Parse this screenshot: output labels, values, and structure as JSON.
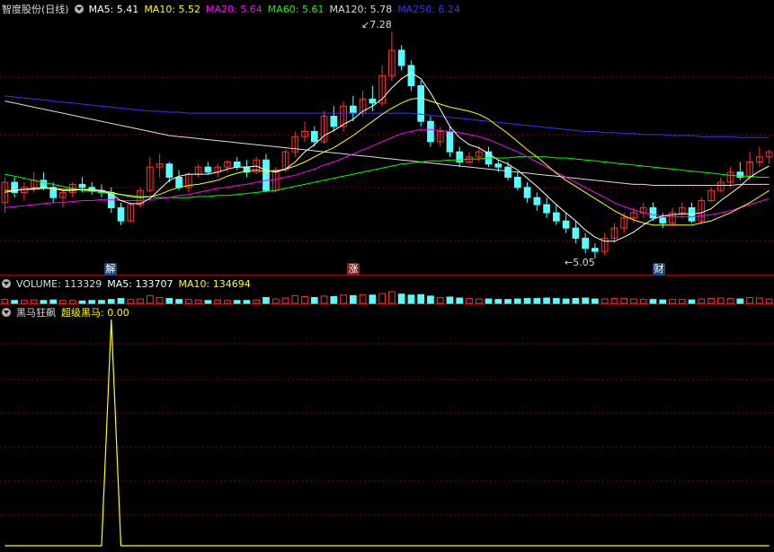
{
  "main": {
    "title": "智度股份(日线)",
    "ma_legend": [
      {
        "label": "MA5: 5.41",
        "color": "#ffffff"
      },
      {
        "label": "MA10: 5.52",
        "color": "#ffff00"
      },
      {
        "label": "MA20: 5.64",
        "color": "#ff00ff"
      },
      {
        "label": "MA60: 5.61",
        "color": "#00ff00"
      },
      {
        "label": "MA120: 5.78",
        "color": "#dddddd"
      },
      {
        "label": "MA250: 6.24",
        "color": "#3333ff"
      }
    ],
    "high_label": "7.28",
    "low_label": "5.05",
    "markers": [
      {
        "text": "解",
        "bg": "#1e4a7a"
      },
      {
        "text": "涨",
        "bg": "#8b1a1a"
      },
      {
        "text": "财",
        "bg": "#1e4a7a"
      }
    ]
  },
  "volume": {
    "title": "VOLUME: 113329",
    "ma5": "MA5: 133707",
    "ma10": "MA10: 134694"
  },
  "indicator": {
    "title": "黑马狂飙",
    "series_label": "超级黑马: 0.00"
  },
  "colors": {
    "up": "#ff3030",
    "down": "#54ffff",
    "grid": "#8b0000",
    "ma5": "#ffffff",
    "ma10": "#ffff00",
    "ma20": "#ff00ff",
    "ma60": "#00ff00",
    "ma120": "#dddddd",
    "ma250": "#3333ff",
    "indicator": "#ffff00"
  },
  "chart_data": {
    "type": "candlestick",
    "ylim": [
      4.9,
      7.4
    ],
    "candles": [
      [
        5.6,
        5.85,
        5.5,
        5.8
      ],
      [
        5.8,
        5.85,
        5.65,
        5.7
      ],
      [
        5.7,
        5.8,
        5.62,
        5.75
      ],
      [
        5.75,
        5.9,
        5.7,
        5.82
      ],
      [
        5.82,
        5.9,
        5.72,
        5.75
      ],
      [
        5.75,
        5.8,
        5.6,
        5.65
      ],
      [
        5.65,
        5.72,
        5.55,
        5.7
      ],
      [
        5.7,
        5.8,
        5.65,
        5.78
      ],
      [
        5.78,
        5.85,
        5.7,
        5.75
      ],
      [
        5.75,
        5.8,
        5.68,
        5.72
      ],
      [
        5.72,
        5.78,
        5.65,
        5.7
      ],
      [
        5.7,
        5.75,
        5.5,
        5.55
      ],
      [
        5.55,
        5.6,
        5.38,
        5.42
      ],
      [
        5.42,
        5.6,
        5.4,
        5.58
      ],
      [
        5.58,
        5.75,
        5.55,
        5.72
      ],
      [
        5.72,
        6.05,
        5.7,
        5.95
      ],
      [
        5.95,
        6.08,
        5.85,
        5.98
      ],
      [
        5.98,
        6.0,
        5.8,
        5.85
      ],
      [
        5.85,
        5.92,
        5.72,
        5.75
      ],
      [
        5.75,
        5.9,
        5.7,
        5.88
      ],
      [
        5.88,
        5.98,
        5.85,
        5.95
      ],
      [
        5.95,
        6.0,
        5.88,
        5.9
      ],
      [
        5.9,
        5.98,
        5.85,
        5.95
      ],
      [
        5.95,
        6.02,
        5.9,
        6.0
      ],
      [
        6.0,
        6.05,
        5.92,
        5.95
      ],
      [
        5.95,
        6.02,
        5.85,
        5.9
      ],
      [
        5.9,
        6.05,
        5.88,
        6.02
      ],
      [
        6.02,
        6.08,
        5.7,
        5.72
      ],
      [
        5.72,
        5.95,
        5.7,
        5.92
      ],
      [
        5.92,
        6.12,
        5.9,
        6.1
      ],
      [
        6.1,
        6.3,
        6.05,
        6.25
      ],
      [
        6.25,
        6.4,
        6.2,
        6.3
      ],
      [
        6.3,
        6.35,
        6.15,
        6.2
      ],
      [
        6.2,
        6.5,
        6.18,
        6.45
      ],
      [
        6.45,
        6.55,
        6.3,
        6.35
      ],
      [
        6.35,
        6.6,
        6.3,
        6.55
      ],
      [
        6.55,
        6.65,
        6.4,
        6.48
      ],
      [
        6.48,
        6.7,
        6.45,
        6.62
      ],
      [
        6.62,
        6.75,
        6.5,
        6.58
      ],
      [
        6.58,
        6.95,
        6.55,
        6.85
      ],
      [
        6.85,
        7.28,
        6.8,
        7.1
      ],
      [
        7.1,
        7.15,
        6.9,
        6.95
      ],
      [
        6.95,
        7.0,
        6.7,
        6.75
      ],
      [
        6.75,
        6.8,
        6.35,
        6.4
      ],
      [
        6.4,
        6.45,
        6.15,
        6.2
      ],
      [
        6.2,
        6.35,
        6.15,
        6.3
      ],
      [
        6.3,
        6.35,
        6.05,
        6.1
      ],
      [
        6.1,
        6.15,
        5.95,
        6.0
      ],
      [
        6.0,
        6.1,
        5.98,
        6.05
      ],
      [
        6.05,
        6.15,
        6.0,
        6.1
      ],
      [
        6.1,
        6.15,
        5.95,
        5.98
      ],
      [
        5.98,
        6.02,
        5.9,
        5.95
      ],
      [
        5.95,
        6.0,
        5.82,
        5.85
      ],
      [
        5.85,
        5.9,
        5.72,
        5.75
      ],
      [
        5.75,
        5.8,
        5.6,
        5.65
      ],
      [
        5.65,
        5.7,
        5.52,
        5.58
      ],
      [
        5.58,
        5.65,
        5.45,
        5.5
      ],
      [
        5.5,
        5.58,
        5.38,
        5.42
      ],
      [
        5.42,
        5.5,
        5.3,
        5.35
      ],
      [
        5.35,
        5.42,
        5.2,
        5.25
      ],
      [
        5.25,
        5.3,
        5.1,
        5.15
      ],
      [
        5.15,
        5.2,
        5.05,
        5.12
      ],
      [
        5.12,
        5.3,
        5.08,
        5.25
      ],
      [
        5.25,
        5.4,
        5.2,
        5.35
      ],
      [
        5.35,
        5.5,
        5.3,
        5.45
      ],
      [
        5.45,
        5.55,
        5.4,
        5.5
      ],
      [
        5.5,
        5.6,
        5.45,
        5.55
      ],
      [
        5.55,
        5.6,
        5.42,
        5.45
      ],
      [
        5.45,
        5.5,
        5.35,
        5.4
      ],
      [
        5.4,
        5.55,
        5.38,
        5.5
      ],
      [
        5.5,
        5.6,
        5.45,
        5.55
      ],
      [
        5.55,
        5.6,
        5.4,
        5.42
      ],
      [
        5.42,
        5.65,
        5.4,
        5.62
      ],
      [
        5.62,
        5.75,
        5.6,
        5.72
      ],
      [
        5.72,
        5.85,
        5.7,
        5.8
      ],
      [
        5.8,
        5.95,
        5.75,
        5.9
      ],
      [
        5.9,
        6.0,
        5.82,
        5.85
      ],
      [
        5.85,
        6.1,
        5.82,
        6.0
      ],
      [
        6.0,
        6.15,
        5.95,
        6.05
      ],
      [
        6.05,
        6.12,
        5.98,
        6.1
      ]
    ],
    "ma5": [
      5.7,
      5.72,
      5.73,
      5.74,
      5.75,
      5.74,
      5.72,
      5.72,
      5.73,
      5.72,
      5.72,
      5.68,
      5.62,
      5.59,
      5.59,
      5.64,
      5.73,
      5.82,
      5.86,
      5.88,
      5.88,
      5.88,
      5.9,
      5.93,
      5.95,
      5.95,
      5.96,
      5.92,
      5.9,
      5.93,
      6.0,
      6.1,
      6.17,
      6.26,
      6.31,
      6.37,
      6.42,
      6.5,
      6.55,
      6.62,
      6.73,
      6.82,
      6.88,
      6.82,
      6.68,
      6.52,
      6.35,
      6.24,
      6.17,
      6.14,
      6.08,
      6.02,
      5.98,
      5.92,
      5.84,
      5.76,
      5.67,
      5.58,
      5.5,
      5.42,
      5.33,
      5.26,
      5.22,
      5.22,
      5.26,
      5.31,
      5.38,
      5.44,
      5.47,
      5.48,
      5.49,
      5.49,
      5.5,
      5.54,
      5.62,
      5.69,
      5.76,
      5.85,
      5.91,
      5.96
    ],
    "ma10": [
      5.72,
      5.72,
      5.73,
      5.73,
      5.74,
      5.74,
      5.73,
      5.73,
      5.73,
      5.73,
      5.72,
      5.7,
      5.68,
      5.66,
      5.65,
      5.66,
      5.68,
      5.72,
      5.75,
      5.77,
      5.78,
      5.8,
      5.82,
      5.86,
      5.89,
      5.91,
      5.92,
      5.91,
      5.91,
      5.93,
      5.96,
      6.0,
      6.05,
      6.1,
      6.14,
      6.2,
      6.26,
      6.33,
      6.4,
      6.47,
      6.53,
      6.58,
      6.62,
      6.63,
      6.6,
      6.57,
      6.54,
      6.52,
      6.5,
      6.47,
      6.42,
      6.35,
      6.28,
      6.2,
      6.12,
      6.05,
      5.97,
      5.89,
      5.82,
      5.76,
      5.7,
      5.64,
      5.58,
      5.52,
      5.47,
      5.43,
      5.4,
      5.38,
      5.38,
      5.38,
      5.38,
      5.38,
      5.4,
      5.42,
      5.46,
      5.5,
      5.55,
      5.6,
      5.66,
      5.72
    ],
    "ma20": [
      5.55,
      5.56,
      5.57,
      5.58,
      5.59,
      5.6,
      5.6,
      5.61,
      5.62,
      5.62,
      5.63,
      5.63,
      5.62,
      5.62,
      5.62,
      5.63,
      5.64,
      5.65,
      5.67,
      5.68,
      5.7,
      5.72,
      5.74,
      5.75,
      5.77,
      5.78,
      5.8,
      5.82,
      5.83,
      5.85,
      5.87,
      5.9,
      5.93,
      5.97,
      6.0,
      6.04,
      6.08,
      6.12,
      6.16,
      6.2,
      6.24,
      6.28,
      6.3,
      6.32,
      6.32,
      6.31,
      6.3,
      6.29,
      6.27,
      6.25,
      6.22,
      6.18,
      6.14,
      6.1,
      6.05,
      6.0,
      5.95,
      5.9,
      5.85,
      5.8,
      5.75,
      5.7,
      5.65,
      5.6,
      5.56,
      5.53,
      5.5,
      5.48,
      5.47,
      5.46,
      5.46,
      5.46,
      5.47,
      5.48,
      5.5,
      5.52,
      5.55,
      5.58,
      5.61,
      5.64
    ],
    "ma60": [
      5.88,
      5.86,
      5.84,
      5.82,
      5.8,
      5.78,
      5.76,
      5.74,
      5.72,
      5.71,
      5.7,
      5.69,
      5.68,
      5.67,
      5.66,
      5.66,
      5.65,
      5.65,
      5.65,
      5.65,
      5.66,
      5.66,
      5.67,
      5.67,
      5.68,
      5.69,
      5.7,
      5.71,
      5.72,
      5.74,
      5.76,
      5.78,
      5.8,
      5.82,
      5.84,
      5.86,
      5.88,
      5.9,
      5.92,
      5.94,
      5.96,
      5.98,
      5.99,
      6.0,
      6.01,
      6.01,
      6.02,
      6.02,
      6.03,
      6.03,
      6.04,
      6.04,
      6.04,
      6.05,
      6.05,
      6.05,
      6.05,
      6.04,
      6.04,
      6.03,
      6.02,
      6.01,
      6.0,
      5.99,
      5.98,
      5.97,
      5.96,
      5.95,
      5.94,
      5.93,
      5.92,
      5.91,
      5.9,
      5.89,
      5.88,
      5.87,
      5.86,
      5.86,
      5.85,
      5.85
    ],
    "ma120": [
      6.6,
      6.58,
      6.56,
      6.54,
      6.52,
      6.5,
      6.48,
      6.46,
      6.44,
      6.42,
      6.4,
      6.38,
      6.36,
      6.34,
      6.32,
      6.3,
      6.28,
      6.26,
      6.25,
      6.24,
      6.23,
      6.22,
      6.21,
      6.2,
      6.19,
      6.18,
      6.17,
      6.16,
      6.15,
      6.14,
      6.13,
      6.12,
      6.11,
      6.1,
      6.09,
      6.08,
      6.07,
      6.06,
      6.05,
      6.04,
      6.03,
      6.02,
      6.01,
      6.0,
      5.99,
      5.98,
      5.97,
      5.96,
      5.95,
      5.94,
      5.93,
      5.92,
      5.91,
      5.9,
      5.89,
      5.88,
      5.87,
      5.86,
      5.85,
      5.84,
      5.83,
      5.82,
      5.81,
      5.8,
      5.79,
      5.78,
      5.78,
      5.77,
      5.77,
      5.77,
      5.77,
      5.77,
      5.77,
      5.77,
      5.77,
      5.77,
      5.78,
      5.78,
      5.78,
      5.78
    ],
    "ma250": [
      6.65,
      6.64,
      6.63,
      6.62,
      6.61,
      6.6,
      6.59,
      6.58,
      6.57,
      6.56,
      6.55,
      6.54,
      6.53,
      6.52,
      6.51,
      6.5,
      6.5,
      6.49,
      6.49,
      6.48,
      6.48,
      6.48,
      6.48,
      6.48,
      6.48,
      6.48,
      6.48,
      6.48,
      6.48,
      6.48,
      6.48,
      6.48,
      6.48,
      6.48,
      6.48,
      6.48,
      6.48,
      6.48,
      6.48,
      6.48,
      6.48,
      6.48,
      6.48,
      6.47,
      6.46,
      6.45,
      6.44,
      6.43,
      6.42,
      6.41,
      6.4,
      6.39,
      6.38,
      6.37,
      6.36,
      6.35,
      6.34,
      6.33,
      6.32,
      6.31,
      6.3,
      6.3,
      6.29,
      6.29,
      6.28,
      6.28,
      6.27,
      6.27,
      6.27,
      6.26,
      6.26,
      6.26,
      6.25,
      6.25,
      6.25,
      6.25,
      6.24,
      6.24,
      6.24,
      6.24
    ],
    "volume": [
      0.4,
      0.3,
      0.3,
      0.35,
      0.3,
      0.35,
      0.3,
      0.3,
      0.25,
      0.3,
      0.3,
      0.4,
      0.5,
      0.4,
      0.45,
      0.8,
      0.6,
      0.5,
      0.4,
      0.4,
      0.35,
      0.3,
      0.35,
      0.3,
      0.3,
      0.3,
      0.35,
      0.6,
      0.45,
      0.55,
      0.8,
      0.7,
      0.6,
      0.75,
      0.7,
      0.85,
      0.8,
      0.9,
      0.85,
      1.0,
      1.2,
      0.95,
      0.85,
      0.9,
      0.75,
      0.6,
      0.65,
      0.55,
      0.5,
      0.45,
      0.45,
      0.4,
      0.4,
      0.45,
      0.5,
      0.5,
      0.55,
      0.5,
      0.45,
      0.5,
      0.55,
      0.45,
      0.45,
      0.5,
      0.5,
      0.45,
      0.4,
      0.4,
      0.35,
      0.4,
      0.4,
      0.35,
      0.45,
      0.5,
      0.55,
      0.5,
      0.45,
      0.6,
      0.55,
      0.45
    ],
    "indicator": {
      "peak_index": 11,
      "peak_value": 1,
      "baseline": 0
    }
  }
}
